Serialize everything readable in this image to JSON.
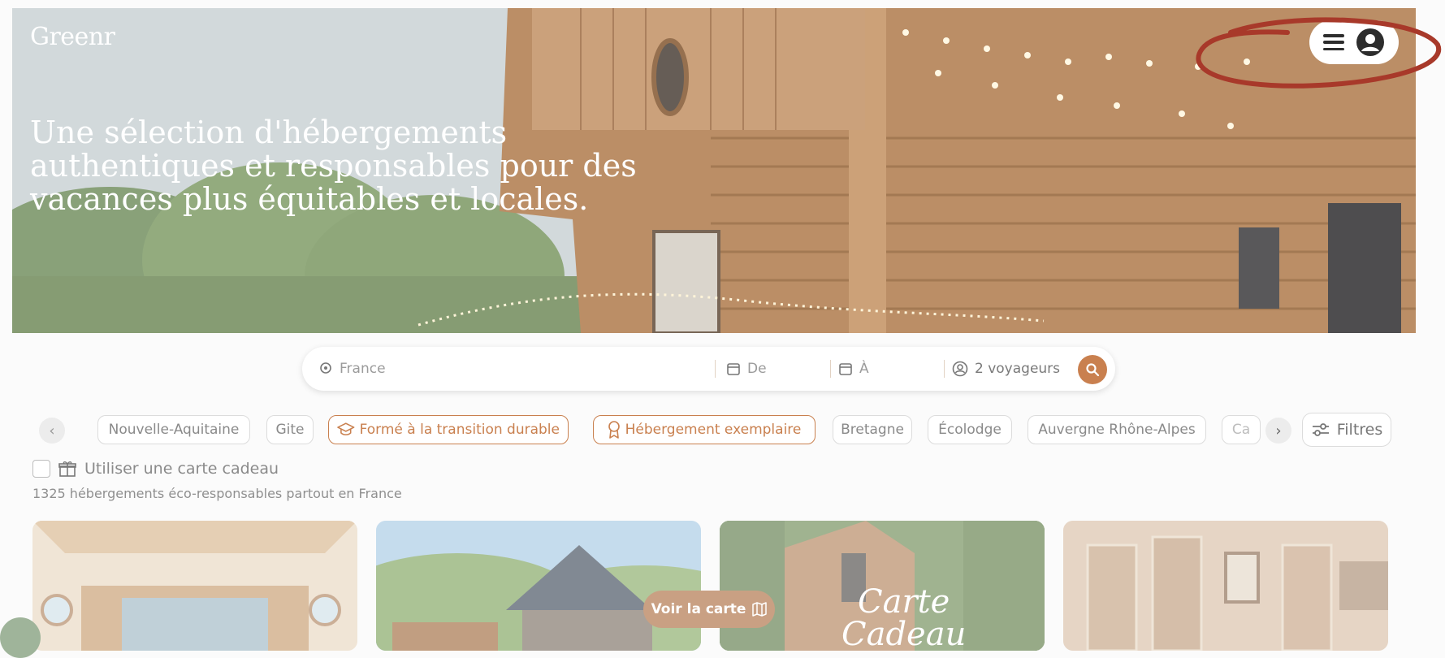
{
  "brand": {
    "logo": "Greenr"
  },
  "hero": {
    "headline": "Une sélection d'hébergements authentiques et responsables pour des vacances plus équitables et locales."
  },
  "header": {
    "menu_icon": "hamburger-icon",
    "account_icon": "user-icon"
  },
  "search": {
    "location_placeholder": "France",
    "from_placeholder": "De",
    "to_placeholder": "À",
    "travelers": "2 voyageurs"
  },
  "chips": [
    {
      "label": "Nouvelle-Aquitaine"
    },
    {
      "label": "Gite"
    },
    {
      "label": "Formé à la transition durable",
      "icon": "graduation-cap-icon"
    },
    {
      "label": "Hébergement exemplaire",
      "icon": "award-ribbon-icon"
    },
    {
      "label": "Bretagne"
    },
    {
      "label": "Écolodge"
    },
    {
      "label": "Auvergne Rhône-Alpes"
    },
    {
      "label": "Ca"
    }
  ],
  "filters_label": "Filtres",
  "gift_card": {
    "label": "Utiliser une carte cadeau"
  },
  "results_count": "1325 hébergements éco-responsables partout en France",
  "map_button": "Voir la carte",
  "cards": [
    {
      "name": "listing-card-1"
    },
    {
      "name": "listing-card-2"
    },
    {
      "name": "gift-card-promo",
      "overlay_text_1": "Carte",
      "overlay_text_2": "Cadeau"
    },
    {
      "name": "listing-card-4"
    }
  ],
  "colors": {
    "accent": "#c9804f",
    "annotation": "#a8392a"
  }
}
